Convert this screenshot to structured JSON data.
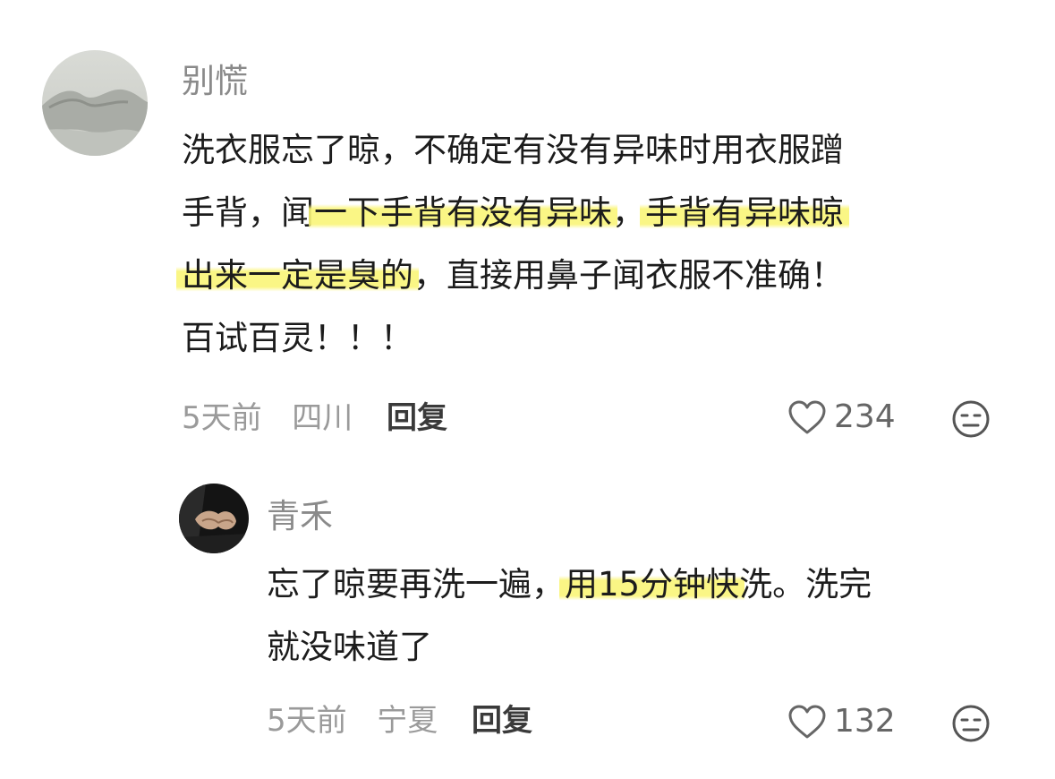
{
  "comments": [
    {
      "name": "别慌",
      "text_lines": [
        [
          {
            "t": "洗衣服忘了晾，不确定有没有异味时用衣服蹭",
            "hl": false
          }
        ],
        [
          {
            "t": "手背，闻",
            "hl": false
          },
          {
            "t": "一下手背有没有异味",
            "hl": true
          },
          {
            "t": "，",
            "hl": false
          },
          {
            "t": "手背有异味晾",
            "hl": true
          }
        ],
        [
          {
            "t": "出来一定是臭的",
            "hl": true
          },
          {
            "t": "，直接用鼻子闻衣服不准确！",
            "hl": false
          }
        ],
        [
          {
            "t": "百试百灵！！！",
            "hl": false
          }
        ]
      ],
      "time": "5天前",
      "location": "四川",
      "reply_label": "回复",
      "likes": "234"
    },
    {
      "name": "青禾",
      "text_lines": [
        [
          {
            "t": "忘了晾要再洗一遍，",
            "hl": false
          },
          {
            "t": "用15分钟快",
            "hl": true
          },
          {
            "t": "洗。洗完",
            "hl": false
          }
        ],
        [
          {
            "t": "就没味道了",
            "hl": false
          }
        ]
      ],
      "time": "5天前",
      "location": "宁夏",
      "reply_label": "回复",
      "likes": "132"
    }
  ],
  "colors": {
    "highlight": "#faf578",
    "meta_text": "#9a9a9a",
    "name_text": "#8a8a8a",
    "body_text": "#1c1c1c"
  },
  "icons": {
    "like": "heart-outline-icon",
    "more": "neutral-face-emoji-icon"
  }
}
